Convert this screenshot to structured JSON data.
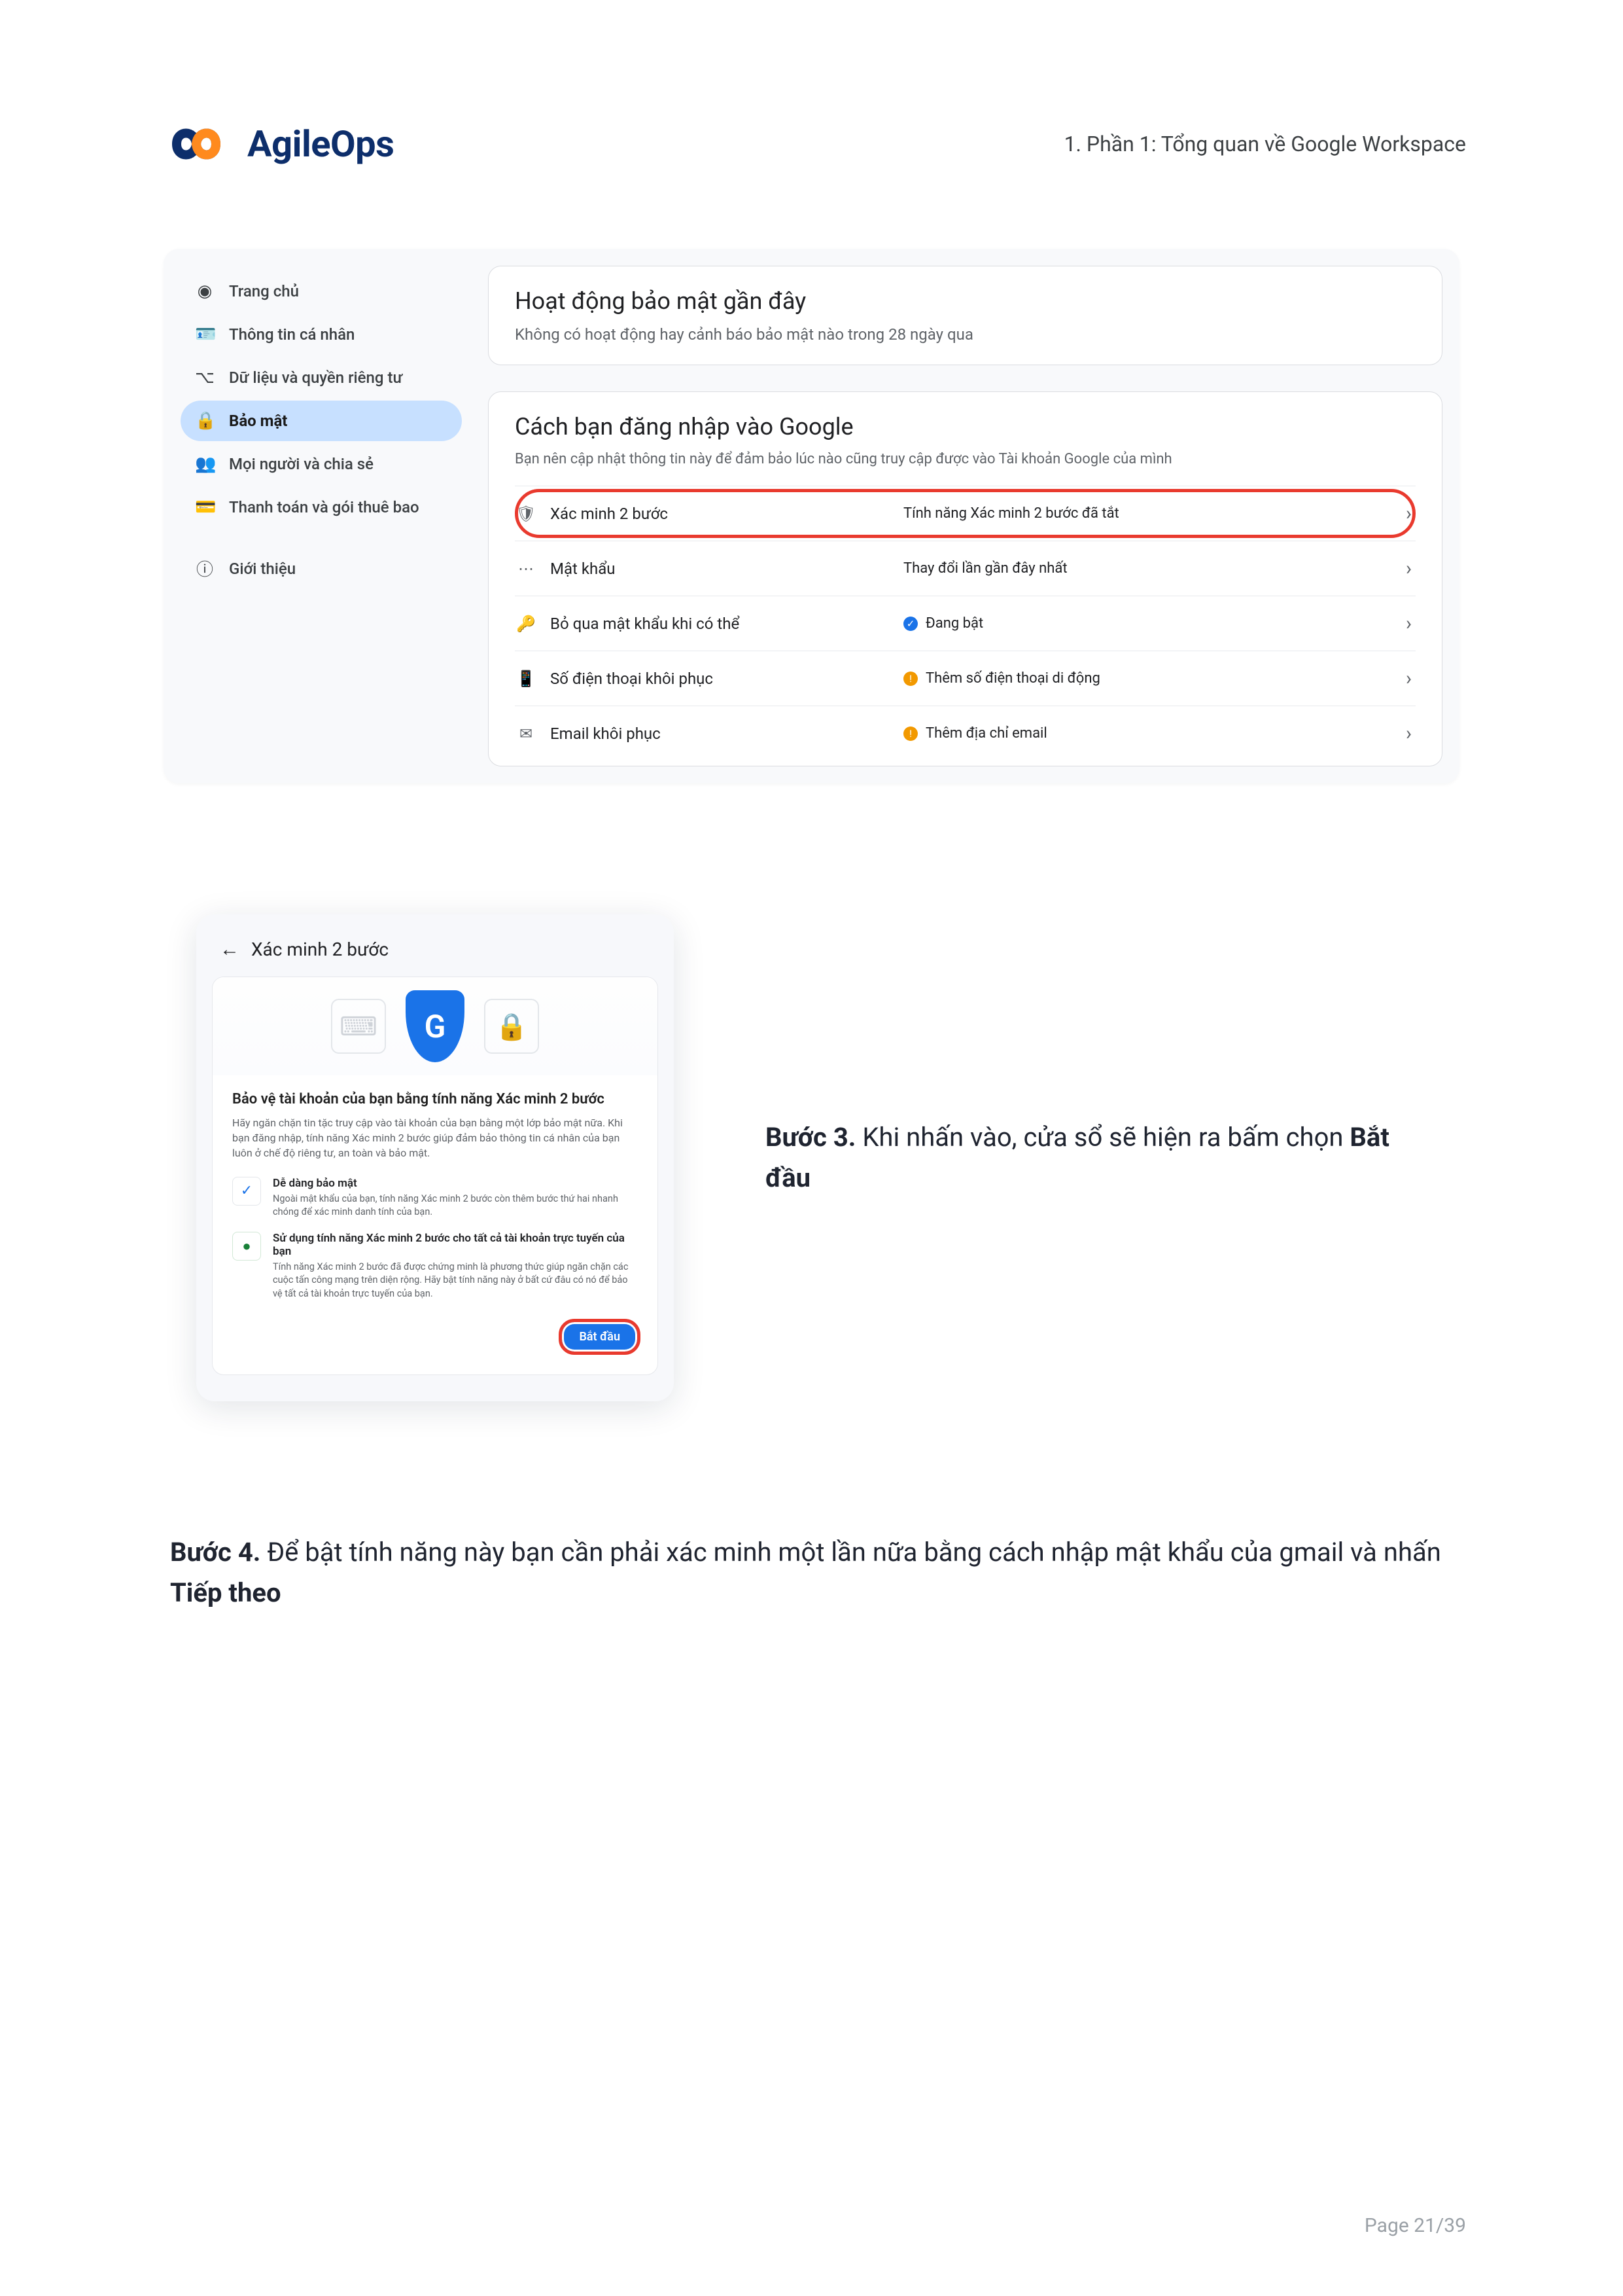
{
  "header": {
    "logo_text": "AgileOps",
    "breadcrumb": "1. Phần 1: Tổng quan về Google Workspace"
  },
  "panel1": {
    "sidebar": [
      {
        "icon": "◉",
        "label": "Trang chủ"
      },
      {
        "icon": "🪪",
        "label": "Thông tin cá nhân"
      },
      {
        "icon": "⌥",
        "label": "Dữ liệu và quyền riêng tư"
      },
      {
        "icon": "🔒",
        "label": "Bảo mật"
      },
      {
        "icon": "👥",
        "label": "Mọi người và chia sẻ"
      },
      {
        "icon": "💳",
        "label": "Thanh toán và gói thuê bao"
      },
      {
        "icon": "ⓘ",
        "label": "Giới thiệu"
      }
    ],
    "activity": {
      "title": "Hoạt động bảo mật gần đây",
      "subtitle": "Không có hoạt động hay cảnh báo bảo mật nào trong 28 ngày qua"
    },
    "signin": {
      "title": "Cách bạn đăng nhập vào Google",
      "subtitle": "Bạn nên cập nhật thông tin này để đảm bảo lúc nào cũng truy cập được vào Tài khoản Google của mình",
      "rows": [
        {
          "icon": "🛡",
          "label": "Xác minh 2 bước",
          "status_icon": "",
          "status": "Tính năng Xác minh 2 bước đã tắt",
          "hl": true
        },
        {
          "icon": "⋯",
          "label": "Mật khẩu",
          "status_icon": "",
          "status": "Thay đổi lần gần đây nhất"
        },
        {
          "icon": "🔑",
          "label": "Bỏ qua mật khẩu khi có thể",
          "status_icon": "blue",
          "status": "Đang bật"
        },
        {
          "icon": "📱",
          "label": "Số điện thoại khôi phục",
          "status_icon": "orange",
          "status": "Thêm số điện thoại di động"
        },
        {
          "icon": "✉",
          "label": "Email khôi phục",
          "status_icon": "orange",
          "status": "Thêm địa chỉ email"
        }
      ]
    }
  },
  "panel2": {
    "back_label": "Xác minh 2 bước",
    "card_title": "Bảo vệ tài khoản của bạn bằng tính năng Xác minh 2 bước",
    "card_desc": "Hãy ngăn chặn tin tặc truy cập vào tài khoản của bạn bằng một lớp bảo mật nữa. Khi bạn đăng nhập, tính năng Xác minh 2 bước giúp đảm bảo thông tin cá nhân của bạn luôn ở chế độ riêng tư, an toàn và bảo mật.",
    "features": [
      {
        "title": "Dễ dàng bảo mật",
        "desc": "Ngoài mật khẩu của bạn, tính năng Xác minh 2 bước còn thêm bước thứ hai nhanh chóng để xác minh danh tính của bạn."
      },
      {
        "title": "Sử dụng tính năng Xác minh 2 bước cho tất cả tài khoản trực tuyến của bạn",
        "desc": "Tính năng Xác minh 2 bước đã được chứng minh là phương thức giúp ngăn chặn các cuộc tấn công mạng trên diện rộng. Hãy bật tính năng này ở bất cứ đâu có nó để bảo vệ tất cả tài khoản trực tuyến của bạn."
      }
    ],
    "start_btn": "Bắt đầu"
  },
  "step3": {
    "label": "Bước 3. ",
    "text_before": "Khi nhấn vào, cửa sổ sẽ hiện ra bấm chọn ",
    "bold": "Bắt đầu"
  },
  "step4": {
    "label": "Bước 4. ",
    "text_before": "Để bật tính năng này bạn cần phải xác minh một lần nữa bằng cách nhập mật khẩu của gmail và nhấn ",
    "bold": "Tiếp theo"
  },
  "footer": "Page 21/39"
}
